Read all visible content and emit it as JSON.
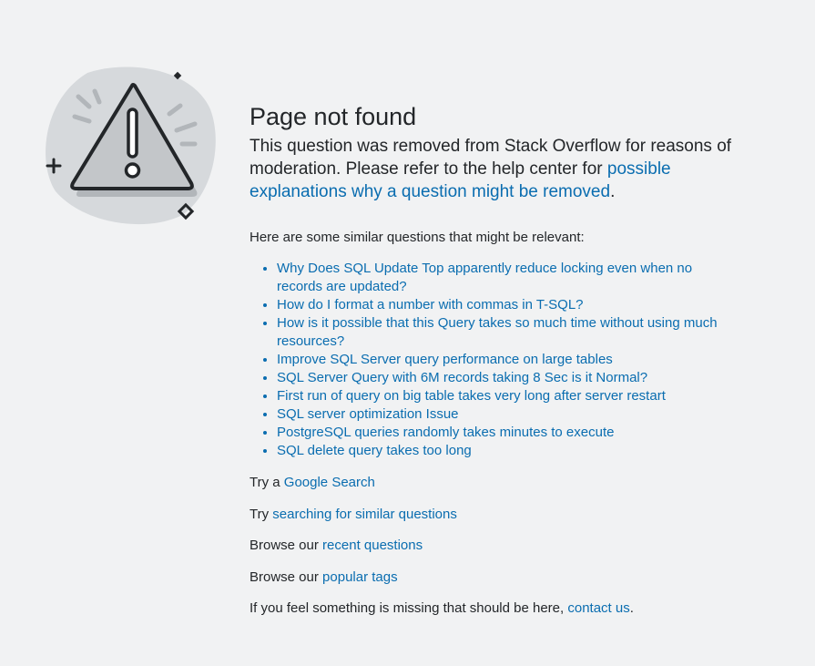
{
  "title": "Page not found",
  "lead": {
    "text": "This question was removed from Stack Overflow for reasons of moderation. Please refer to the help center for ",
    "link": "possible explanations why a question might be removed",
    "after": "."
  },
  "similar": {
    "intro": "Here are some similar questions that might be relevant:",
    "items": [
      "Why Does SQL Update Top apparently reduce locking even when no records are updated?",
      "How do I format a number with commas in T-SQL?",
      "How is it possible that this Query takes so much time without using much resources?",
      "Improve SQL Server query performance on large tables",
      "SQL Server Query with 6M records taking 8 Sec is it Normal?",
      "First run of query on big table takes very long after server restart",
      "SQL server optimization Issue",
      "PostgreSQL queries randomly takes minutes to execute",
      "SQL delete query takes too long"
    ]
  },
  "google": {
    "prefix": "Try a ",
    "link": "Google Search"
  },
  "search_similar": {
    "prefix": "Try ",
    "link": "searching for similar questions"
  },
  "recent": {
    "prefix": "Browse our ",
    "link": "recent questions"
  },
  "popular": {
    "prefix": "Browse our ",
    "link": "popular tags"
  },
  "contact": {
    "prefix": "If you feel something is missing that should be here, ",
    "link": "contact us",
    "after": "."
  },
  "colors": {
    "background": "#f1f2f3",
    "link": "#0a6db0",
    "text": "#232629"
  },
  "icons": [
    "warning-triangle-icon",
    "sparkle-plus-icon",
    "sparkle-diamond-icon"
  ]
}
